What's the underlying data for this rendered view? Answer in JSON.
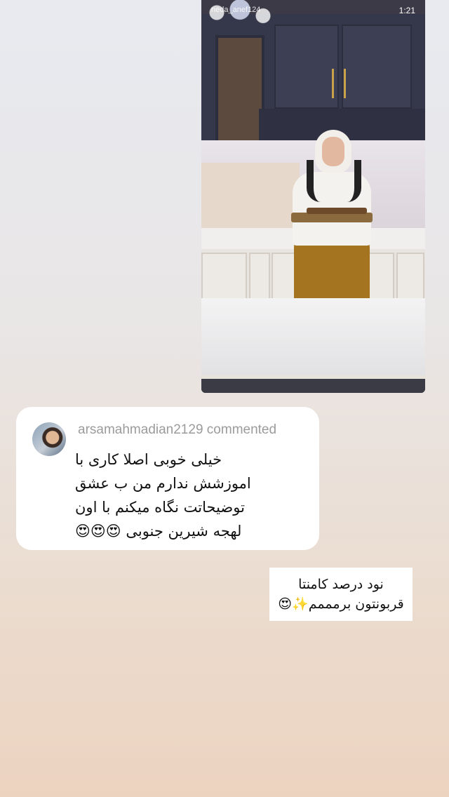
{
  "video": {
    "username": "neda_anef124",
    "time": "1:21"
  },
  "comment": {
    "username": "arsamahmadian2129",
    "action": "commented",
    "text": "خیلی خوبی اصلا کاری با\nاموزشش ندارم من ب عشق\nتوضیحاتت نگاه میکنم با اون\nلهجه شیرین جنوبی 😍😍😍"
  },
  "reply": {
    "text": "نود درصد کامنتا\nقربونتون برمممم✨😍"
  }
}
